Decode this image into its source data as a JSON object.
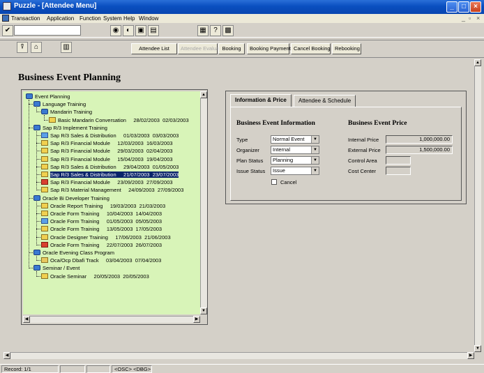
{
  "window": {
    "title": "Puzzle - [Attendee Menu]"
  },
  "menu": [
    "Transaction",
    "Application",
    "Function",
    "System",
    "Help",
    "Window"
  ],
  "toolbar2": {
    "buttons": [
      {
        "label": "Attendee List",
        "enabled": true
      },
      {
        "label": "Attendee Evaluation",
        "enabled": false
      },
      {
        "label": "Booking",
        "enabled": true
      },
      {
        "label": "Booking Payment",
        "enabled": true
      },
      {
        "label": "Cancel Booking",
        "enabled": true
      },
      {
        "label": "Rebooking",
        "enabled": true
      }
    ]
  },
  "page_title": "Business Event Planning",
  "tree": [
    {
      "label": "Event Planning",
      "icon": "group-icon",
      "level": 0
    },
    {
      "label": "Language Training",
      "icon": "group-icon",
      "level": 1
    },
    {
      "label": "Mandarin Training",
      "icon": "group-icon",
      "level": 2
    },
    {
      "label": "Basic Mandarin Conversation",
      "dates": "28/02/2003  02/03/2003",
      "icon": "yellow-event-icon",
      "level": 3
    },
    {
      "label": "Sap R/3 Implement Training",
      "icon": "group-icon",
      "level": 1
    },
    {
      "label": "Sap R/3 Sales & Distribution",
      "dates": "01/03/2003  03/03/2003",
      "icon": "blue-event-icon",
      "level": 2
    },
    {
      "label": "Sap R/3 Financial Module",
      "dates": "12/03/2003  16/03/2003",
      "icon": "yellow-event-icon",
      "level": 2
    },
    {
      "label": "Sap R/3 Financial Module",
      "dates": "29/03/2003  02/04/2003",
      "icon": "yellow-event-icon",
      "level": 2
    },
    {
      "label": "Sap R/3 Financial Module",
      "dates": "15/04/2003  19/04/2003",
      "icon": "yellow-event-icon",
      "level": 2
    },
    {
      "label": "Sap R/3 Sales & Distribution",
      "dates": "29/04/2003  01/05/2003",
      "icon": "yellow-event-icon",
      "level": 2
    },
    {
      "label": "Sap R/3 Sales & Distribution",
      "dates": "21/07/2003  23/07/2003",
      "icon": "yellow-event-icon",
      "level": 2,
      "selected": true
    },
    {
      "label": "Sap R/3 Financial Module",
      "dates": "23/09/2003  27/09/2003",
      "icon": "red-event-icon",
      "level": 2
    },
    {
      "label": "Sap R/3 Material Management",
      "dates": "24/09/2003  27/09/2003",
      "icon": "yellow-event-icon",
      "level": 2
    },
    {
      "label": "Oracle Bi Developer Training",
      "icon": "group-icon",
      "level": 1
    },
    {
      "label": "Oracle Report Training",
      "dates": "19/03/2003  21/03/2003",
      "icon": "yellow-event-icon",
      "level": 2
    },
    {
      "label": "Oracle Form Training",
      "dates": "10/04/2003  14/04/2003",
      "icon": "yellow-event-icon",
      "level": 2
    },
    {
      "label": "Oracle Form Training",
      "dates": "01/05/2003  05/05/2003",
      "icon": "blue-event-icon",
      "level": 2
    },
    {
      "label": "Oracle Form Training",
      "dates": "13/05/2003  17/05/2003",
      "icon": "yellow-event-icon",
      "level": 2
    },
    {
      "label": "Oracle Designer Training",
      "dates": "17/06/2003  21/06/2003",
      "icon": "yellow-event-icon",
      "level": 2
    },
    {
      "label": "Oracle Form Training",
      "dates": "22/07/2003  26/07/2003",
      "icon": "red-event-icon",
      "level": 2
    },
    {
      "label": "Oracle Evening Class Program",
      "icon": "group-icon",
      "level": 1
    },
    {
      "label": "Oca/Ocp Dbafi Track",
      "dates": "03/04/2003  07/04/2003",
      "icon": "folder-icon",
      "level": 2
    },
    {
      "label": "Seminar / Event",
      "icon": "group-icon",
      "level": 1
    },
    {
      "label": "Oracle Seminar",
      "dates": "20/05/2003  20/05/2003",
      "icon": "yellow-event-icon",
      "level": 2
    }
  ],
  "tabs": [
    {
      "label": "Information & Price",
      "active": true
    },
    {
      "label": "Attendee & Schedule",
      "active": false
    }
  ],
  "info": {
    "section_title": "Business Event Information",
    "type_label": "Type",
    "type_value": "Normal Event",
    "organizer_label": "Organizer",
    "organizer_value": "Internal",
    "plan_status_label": "Plan Status",
    "plan_status_value": "Planning",
    "issue_status_label": "Issue Status",
    "issue_status_value": "Issue",
    "cancel_label": "Cancel"
  },
  "price": {
    "section_title": "Business Event Price",
    "internal_label": "Internal Price",
    "internal_value": "1,000,000.00",
    "external_label": "External Price",
    "external_value": "1,500,000.00",
    "control_area_label": "Control Area",
    "control_area_value": "",
    "cost_center_label": "Cost Center",
    "cost_center_value": ""
  },
  "status": {
    "record": "Record: 1/1",
    "osc": "<OSC> <DBG>"
  }
}
